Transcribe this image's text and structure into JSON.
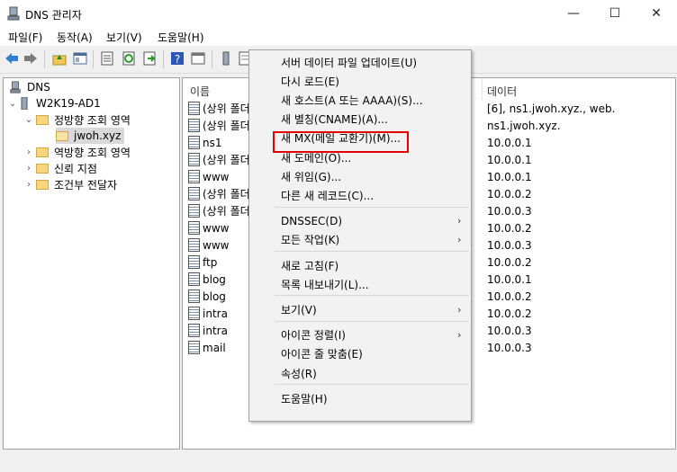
{
  "window": {
    "title": "DNS 관리자",
    "minimize": "—",
    "maximize": "☐",
    "close": "✕"
  },
  "menubar": [
    "파일(F)",
    "동작(A)",
    "보기(V)",
    "도움말(H)"
  ],
  "tree": {
    "root": "DNS",
    "server": "W2K19-AD1",
    "forward": "정방향 조회 영역",
    "zone": "jwoh.xyz",
    "reverse": "역방향 조회 영역",
    "trust": "신뢰 지점",
    "conditional": "조건부 전달자",
    "caret_open": "⌄",
    "caret_closed": "›"
  },
  "list": {
    "col_name": "이름",
    "col_data": "데이터",
    "rows": [
      {
        "name": "(상위 폴더",
        "data": "[6], ns1.jwoh.xyz., web."
      },
      {
        "name": "(상위 폴더",
        "data": "ns1.jwoh.xyz."
      },
      {
        "name": "ns1",
        "data": "10.0.0.1"
      },
      {
        "name": "(상위 폴더",
        "data": "10.0.0.1"
      },
      {
        "name": "www",
        "data": "10.0.0.1"
      },
      {
        "name": "(상위 폴더",
        "data": "10.0.0.2"
      },
      {
        "name": "(상위 폴더",
        "data": "10.0.0.3"
      },
      {
        "name": "www",
        "data": "10.0.0.2"
      },
      {
        "name": "www",
        "data": "10.0.0.3"
      },
      {
        "name": "ftp",
        "data": "10.0.0.2"
      },
      {
        "name": "blog",
        "data": "10.0.0.1"
      },
      {
        "name": "blog",
        "data": "10.0.0.2"
      },
      {
        "name": "intra",
        "data": "10.0.0.2"
      },
      {
        "name": "intra",
        "data": "10.0.0.3"
      },
      {
        "name": "mail",
        "data": "10.0.0.3"
      }
    ]
  },
  "context_menu": {
    "items": [
      {
        "label": "서버 데이터 파일 업데이트(U)"
      },
      {
        "label": "다시 로드(E)"
      },
      {
        "label": "새 호스트(A 또는 AAAA)(S)..."
      },
      {
        "label": "새 별칭(CNAME)(A)..."
      },
      {
        "label": "새 MX(메일 교환기)(M)..."
      },
      {
        "label": "새 도메인(O)..."
      },
      {
        "label": "새 위임(G)..."
      },
      {
        "label": "다른 새 레코드(C)..."
      },
      {
        "label": "DNSSEC(D)",
        "arrow": "›"
      },
      {
        "label": "모든 작업(K)",
        "arrow": "›"
      },
      {
        "label": "새로 고침(F)"
      },
      {
        "label": "목록 내보내기(L)..."
      },
      {
        "label": "보기(V)",
        "arrow": "›"
      },
      {
        "label": "아이콘 정렬(I)",
        "arrow": "›"
      },
      {
        "label": "아이콘 줄 맞춤(E)"
      },
      {
        "label": "속성(R)"
      },
      {
        "label": "도움말(H)"
      }
    ],
    "highlight_color": "#e00000"
  },
  "icons": [
    "dns-icon",
    "back-arrow-icon",
    "forward-arrow-icon",
    "up-folder-icon",
    "console-tree-icon",
    "properties-icon",
    "refresh-icon",
    "export-icon",
    "help-icon",
    "view-icon",
    "server-icon",
    "folder-icon",
    "record-icon"
  ]
}
